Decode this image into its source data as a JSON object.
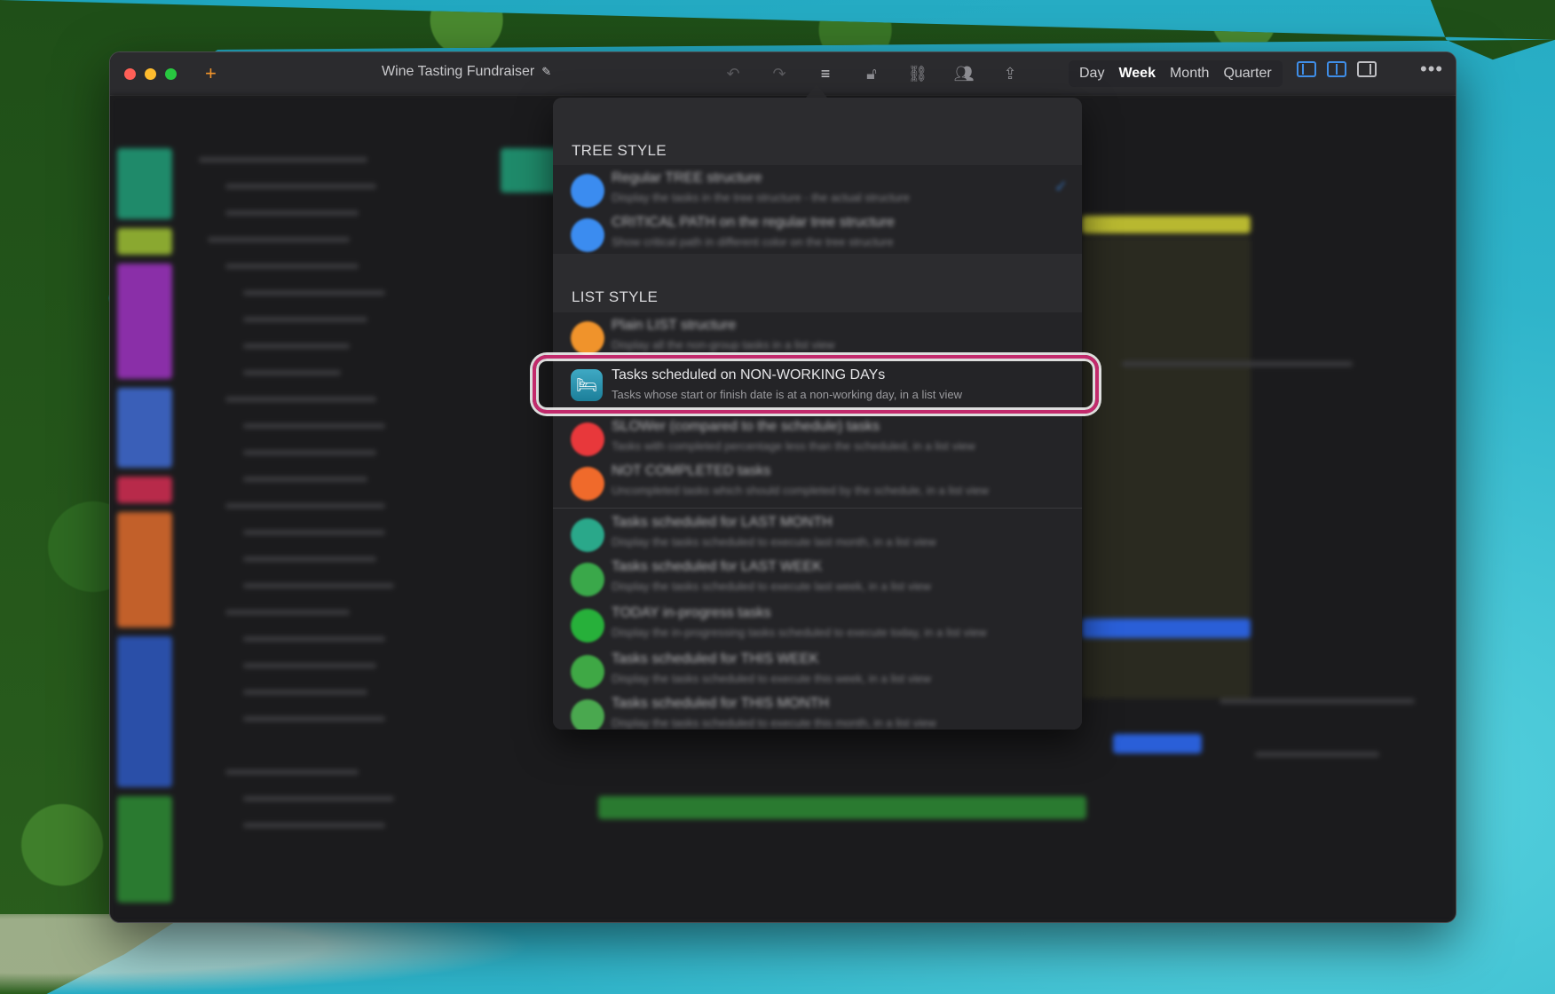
{
  "window": {
    "title": "Wine Tasting Fundraiser"
  },
  "toolbar": {
    "icons": [
      "undo-icon",
      "redo-icon",
      "outline-style-icon",
      "lock-icon",
      "link-icon",
      "people-icon",
      "share-icon"
    ],
    "view_modes": [
      "Day",
      "Week",
      "Month",
      "Quarter"
    ],
    "selected_view": "Week"
  },
  "popover": {
    "tree_section": {
      "heading": "TREE STYLE",
      "items": [
        {
          "title": "Regular TREE structure",
          "subtitle": "Display the tasks in the tree structure - the actual structure",
          "color": "#3b8cf0"
        },
        {
          "title": "CRITICAL PATH on the regular tree structure",
          "subtitle": "Show critical path in different color on the tree structure",
          "color": "#3b8cf0"
        }
      ]
    },
    "list_section": {
      "heading": "LIST STYLE",
      "items": [
        {
          "title": "Plain LIST structure",
          "subtitle": "Display all the non-group tasks in a list view",
          "color": "#f0932b"
        },
        {
          "title": "Tasks scheduled on NON-WORKING DAYs",
          "subtitle": "Tasks whose start or finish date is at a non-working day, in a list view",
          "color": "#2a97b5"
        },
        {
          "title": "SLOWer (compared to the schedule) tasks",
          "subtitle": "Tasks with completed percentage less than the scheduled, in a list view",
          "color": "#e8383b"
        },
        {
          "title": "NOT COMPLETED tasks",
          "subtitle": "Uncompleted tasks which should completed by the schedule, in a list view",
          "color": "#f06a2b"
        },
        {
          "title": "Tasks scheduled for LAST MONTH",
          "subtitle": "Display the tasks scheduled to execute last month, in a list view",
          "color": "#2aa88a"
        },
        {
          "title": "Tasks scheduled for LAST WEEK",
          "subtitle": "Display the tasks scheduled to execute last week, in a list view",
          "color": "#3aa84a"
        },
        {
          "title": "TODAY in-progress tasks",
          "subtitle": "Display the in-progressing tasks scheduled to execute today, in a list view",
          "color": "#27b03a"
        },
        {
          "title": "Tasks scheduled for THIS WEEK",
          "subtitle": "Display the tasks scheduled to execute this week, in a list view",
          "color": "#3fa845"
        },
        {
          "title": "Tasks scheduled for THIS MONTH",
          "subtitle": "Display the tasks scheduled to execute this month, in a list view",
          "color": "#4aa84f"
        }
      ]
    }
  },
  "accent": {
    "highlight": "#c22a6c",
    "selected_pane": "#3f8ee8"
  }
}
